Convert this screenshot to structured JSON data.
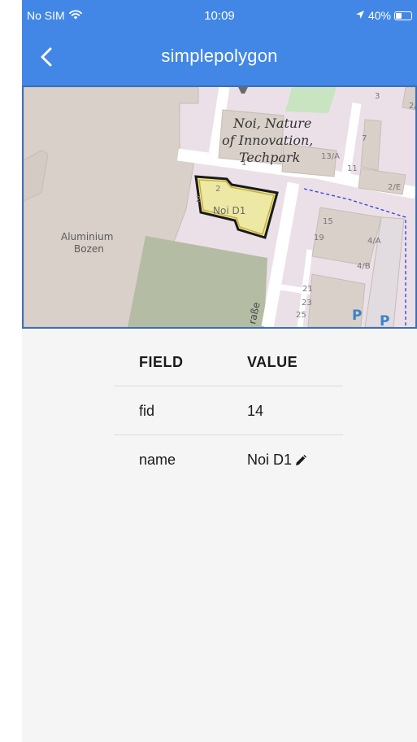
{
  "status_bar": {
    "carrier": "No SIM",
    "time": "10:09",
    "battery_percent": "40%",
    "battery_level": 0.4
  },
  "nav": {
    "title": "simplepolygon",
    "back_icon": "chevron-left-icon"
  },
  "map": {
    "labels": {
      "park_line1": "Noi, Nature",
      "park_line2": "of Innovation,",
      "park_line3": "Techpark",
      "polygon_label": "Noi D1",
      "building_line1": "Aluminium",
      "building_line2": "Bozen",
      "street_fragment": "raße"
    },
    "house_numbers": [
      "3",
      "2/",
      "7",
      "13/A",
      "1",
      "11",
      "2/E",
      "2",
      "2",
      "15",
      "19",
      "4/A",
      "4/B",
      "21",
      "23",
      "25"
    ],
    "parking_label": "P",
    "colors": {
      "background": "#ebe0e8",
      "building": "#d9d0c9",
      "building_edge": "#c7bdb5",
      "road": "#ffffff",
      "green": "#c8e4c0",
      "grass": "#b4bca4",
      "polygon_fill": "#ede9a4",
      "polygon_edge": "#1a1a1a",
      "frame": "#3d6fb6"
    }
  },
  "attributes": {
    "headers": {
      "field": "FIELD",
      "value": "VALUE"
    },
    "rows": [
      {
        "field": "fid",
        "value": "14",
        "editable": false
      },
      {
        "field": "name",
        "value": "Noi D1",
        "editable": true
      }
    ]
  },
  "colors": {
    "header": "#4287e6",
    "content_background": "#f5f5f5"
  }
}
